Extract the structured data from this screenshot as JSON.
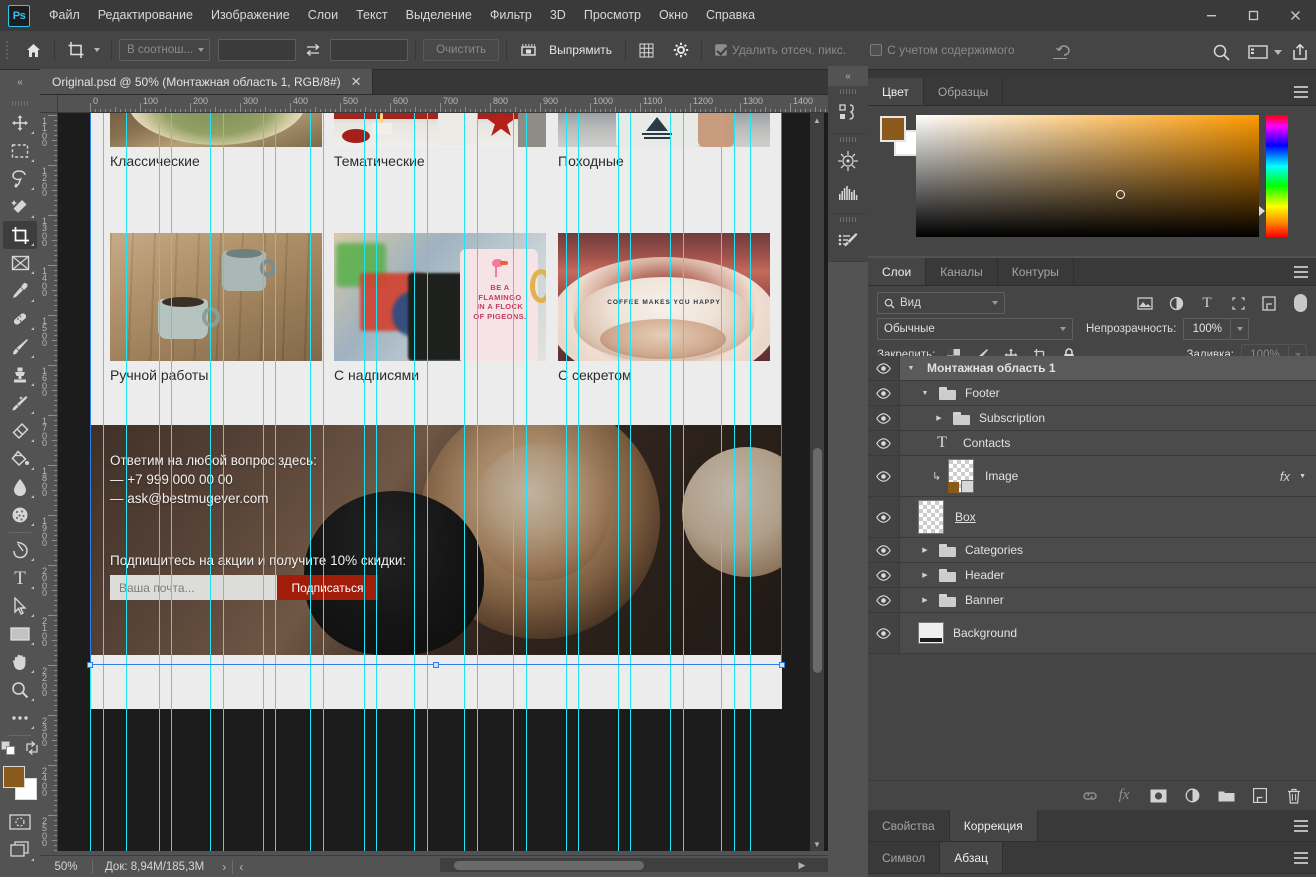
{
  "titlebar": {
    "app_logo": "Ps",
    "menus": [
      "Файл",
      "Редактирование",
      "Изображение",
      "Слои",
      "Текст",
      "Выделение",
      "Фильтр",
      "3D",
      "Просмотр",
      "Окно",
      "Справка"
    ],
    "window_buttons": [
      "minimize",
      "maximize",
      "close"
    ]
  },
  "options_bar": {
    "home_icon": "home-icon",
    "tool_icon": "crop-tool-icon",
    "ratio_select": "В соотнош...",
    "width_value": "",
    "height_value": "",
    "swap_icon": "swap-icon",
    "resolution_value": "",
    "clear_button": "Очистить",
    "straighten_icon": "straighten-icon",
    "straighten_label": "Выпрямить",
    "overlay_icon": "grid-overlay-icon",
    "settings_icon": "gear-icon",
    "delete_cropped_label": "Удалить отсеч. пикс.",
    "delete_cropped_checked": true,
    "content_aware_label": "С учетом содержимого",
    "content_aware_checked": false,
    "reset_icon": "reset-icon",
    "search_icon": "search-icon",
    "workspace_icon": "workspace-icon",
    "workspace_caret": "chevron-down-icon",
    "share_icon": "share-icon"
  },
  "document_tab": {
    "title": "Original.psd @ 50% (Монтажная область 1, RGB/8#)",
    "close_icon": "close-icon",
    "collapse_icon": "collapse-arrows-icon"
  },
  "toolbar": {
    "tools": [
      {
        "name": "move-tool",
        "glyph": "move"
      },
      {
        "name": "marquee-tool",
        "glyph": "marquee"
      },
      {
        "name": "lasso-tool",
        "glyph": "lasso"
      },
      {
        "name": "quick-selection-tool",
        "glyph": "wand"
      },
      {
        "name": "crop-tool",
        "glyph": "crop",
        "active": true
      },
      {
        "name": "frame-tool",
        "glyph": "frame"
      },
      {
        "name": "eyedropper-tool",
        "glyph": "eyedropper"
      },
      {
        "name": "healing-brush-tool",
        "glyph": "heal"
      },
      {
        "name": "brush-tool",
        "glyph": "brush"
      },
      {
        "name": "clone-stamp-tool",
        "glyph": "stamp"
      },
      {
        "name": "history-brush-tool",
        "glyph": "historybrush"
      },
      {
        "name": "eraser-tool",
        "glyph": "eraser"
      },
      {
        "name": "gradient-tool",
        "glyph": "bucket"
      },
      {
        "name": "blur-tool",
        "glyph": "drop"
      },
      {
        "name": "dodge-tool",
        "glyph": "dodge"
      },
      {
        "name": "pen-tool",
        "glyph": "pen"
      },
      {
        "name": "type-tool",
        "glyph": "type"
      },
      {
        "name": "path-selection-tool",
        "glyph": "arrow"
      },
      {
        "name": "rectangle-tool",
        "glyph": "rect"
      },
      {
        "name": "hand-tool",
        "glyph": "hand"
      },
      {
        "name": "zoom-tool",
        "glyph": "zoom"
      },
      {
        "name": "more-tools",
        "glyph": "dots"
      }
    ],
    "foreground_color": "#8a5a1a",
    "background_color": "#ffffff",
    "quickmask_icon": "quick-mask-icon",
    "screenmode_icon": "screen-mode-icon"
  },
  "rulers": {
    "unit": "px",
    "horizontal_labels": [
      "0",
      "100",
      "200",
      "300",
      "400",
      "500",
      "600",
      "700",
      "800",
      "900",
      "1000",
      "1100",
      "1200",
      "1300",
      "1400"
    ],
    "vertical_labels": [
      "1100",
      "1200",
      "1300",
      "1400",
      "1500",
      "1600",
      "1700",
      "1800",
      "1900",
      "2000",
      "2100",
      "2200",
      "2300",
      "2400",
      "2500"
    ],
    "guide_color": "#22e3f2"
  },
  "canvas": {
    "zoom": "50%",
    "cards": [
      {
        "caption": "Классические",
        "name": "card-classic"
      },
      {
        "caption": "Тематические",
        "name": "card-thematic"
      },
      {
        "caption": "Походные",
        "name": "card-hiking"
      },
      {
        "caption": "Ручной работы",
        "name": "card-handmade"
      },
      {
        "caption": "С надписями",
        "name": "card-lettering"
      },
      {
        "caption": "С секретом",
        "name": "card-secret"
      }
    ],
    "mug_text_1": "BE A FLAMINGO IN A FLOCK OF PIGEONS.",
    "mug_text_2": "COFFEE MAKES YOU HAPPY",
    "footer": {
      "contacts_title": "Ответим на любой вопрос здесь:",
      "phone": "— +7 999 000 00 00",
      "email": "— ask@bestmugever.com",
      "subscribe_title": "Подпишитесь на акции и получите 10% скидки:",
      "email_placeholder": "Ваша почта...",
      "subscribe_button": "Подписаться",
      "button_color": "#a11d09"
    }
  },
  "statusbar": {
    "zoom": "50%",
    "doc_info": "Док: 8,94M/185,3M",
    "next_icon": "chevron-right-icon",
    "prev_icon": "chevron-left-icon"
  },
  "icon_rail": {
    "collapse_icon": "collapse-right-icon",
    "groups": [
      [
        {
          "name": "libraries-icon"
        }
      ],
      [
        {
          "name": "history-icon"
        },
        {
          "name": "histogram-icon"
        }
      ],
      [
        {
          "name": "actions-icon"
        }
      ]
    ]
  },
  "color_panel": {
    "tabs": [
      {
        "label": "Цвет",
        "active": true,
        "name": "tab-color"
      },
      {
        "label": "Образцы",
        "active": false,
        "name": "tab-swatches"
      }
    ],
    "menu_icon": "panel-menu-icon",
    "foreground": "#8a5a1a",
    "background": "#ffffff"
  },
  "layers_panel": {
    "tabs": [
      {
        "label": "Слои",
        "active": true,
        "name": "tab-layers"
      },
      {
        "label": "Каналы",
        "active": false,
        "name": "tab-channels"
      },
      {
        "label": "Контуры",
        "active": false,
        "name": "tab-paths"
      }
    ],
    "menu_icon": "panel-menu-icon",
    "filter_label": "Вид",
    "filter_search_icon": "search-icon",
    "filter_icons": [
      "image-filter-icon",
      "adjustment-filter-icon",
      "type-filter-icon",
      "shape-filter-icon",
      "smartobject-filter-icon"
    ],
    "filter_toggle": "filter-toggle",
    "blend_mode": "Обычные",
    "opacity_label": "Непрозрачность:",
    "opacity_value": "100%",
    "lock_label": "Закрепить:",
    "lock_icons": [
      "lock-transparent-icon",
      "lock-image-icon",
      "lock-position-icon",
      "lock-artboard-icon",
      "lock-all-icon"
    ],
    "fill_label": "Заливка:",
    "fill_value": "100%",
    "layers": [
      {
        "name": "Монтажная область 1",
        "type": "artboard",
        "expanded": true,
        "indent": 0,
        "visible": true,
        "selected": true
      },
      {
        "name": "Footer",
        "type": "group",
        "expanded": true,
        "indent": 1,
        "visible": true
      },
      {
        "name": "Subscription",
        "type": "group",
        "expanded": false,
        "indent": 2,
        "visible": true
      },
      {
        "name": "Contacts",
        "type": "text",
        "indent": 2,
        "visible": true
      },
      {
        "name": "Image",
        "type": "clipped-image",
        "indent": 2,
        "visible": true,
        "has_fx": true
      },
      {
        "name": "Box",
        "type": "pixel",
        "indent": 1,
        "visible": true,
        "underlined": true
      },
      {
        "name": "Categories",
        "type": "group",
        "expanded": false,
        "indent": 1,
        "visible": true
      },
      {
        "name": "Header",
        "type": "group",
        "expanded": false,
        "indent": 1,
        "visible": true
      },
      {
        "name": "Banner",
        "type": "group",
        "expanded": false,
        "indent": 1,
        "visible": true
      },
      {
        "name": "Background",
        "type": "image",
        "indent": 1,
        "visible": true
      }
    ],
    "bottom_icons": [
      {
        "name": "link-layers-icon",
        "dim": true
      },
      {
        "name": "layer-style-fx-icon",
        "dim": true
      },
      {
        "name": "layer-mask-icon",
        "dim": false
      },
      {
        "name": "adjustment-layer-icon",
        "dim": false
      },
      {
        "name": "new-group-icon",
        "dim": false
      },
      {
        "name": "new-layer-icon",
        "dim": false
      },
      {
        "name": "delete-layer-icon",
        "dim": false
      }
    ]
  },
  "bottom_panels": [
    {
      "tabs": [
        {
          "label": "Свойства",
          "active": false,
          "name": "tab-properties"
        },
        {
          "label": "Коррекция",
          "active": true,
          "name": "tab-adjustments"
        }
      ],
      "menu_icon": "panel-menu-icon"
    },
    {
      "tabs": [
        {
          "label": "Символ",
          "active": false,
          "name": "tab-character"
        },
        {
          "label": "Абзац",
          "active": true,
          "name": "tab-paragraph"
        }
      ],
      "menu_icon": "panel-menu-icon"
    }
  ]
}
